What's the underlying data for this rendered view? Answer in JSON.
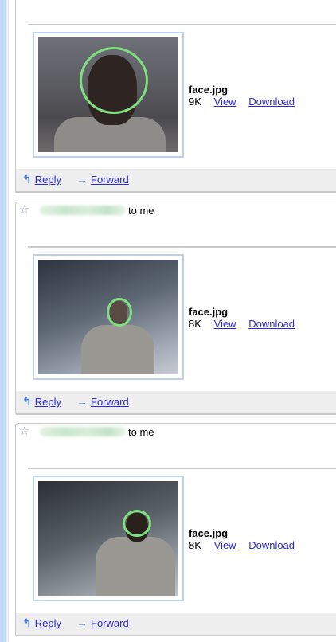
{
  "messages": [
    {
      "sender_suffix": "",
      "attachment": {
        "filename": "face.jpg",
        "size": "9K",
        "view_label": "View",
        "download_label": "Download"
      },
      "actions": {
        "reply_label": "Reply",
        "forward_label": "Forward"
      }
    },
    {
      "sender_suffix": "to me",
      "attachment": {
        "filename": "face.jpg",
        "size": "8K",
        "view_label": "View",
        "download_label": "Download"
      },
      "actions": {
        "reply_label": "Reply",
        "forward_label": "Forward"
      }
    },
    {
      "sender_suffix": "to me",
      "attachment": {
        "filename": "face.jpg",
        "size": "8K",
        "view_label": "View",
        "download_label": "Download"
      },
      "actions": {
        "reply_label": "Reply",
        "forward_label": "Forward"
      }
    }
  ],
  "icons": {
    "star": "star-icon",
    "reply": "reply-arrow-icon",
    "forward": "forward-arrow-icon"
  },
  "colors": {
    "link": "#2a2ad6",
    "face_circle": "#7ee07e",
    "frame": "#bcd0ef",
    "action_bar": "#eeeeee"
  }
}
